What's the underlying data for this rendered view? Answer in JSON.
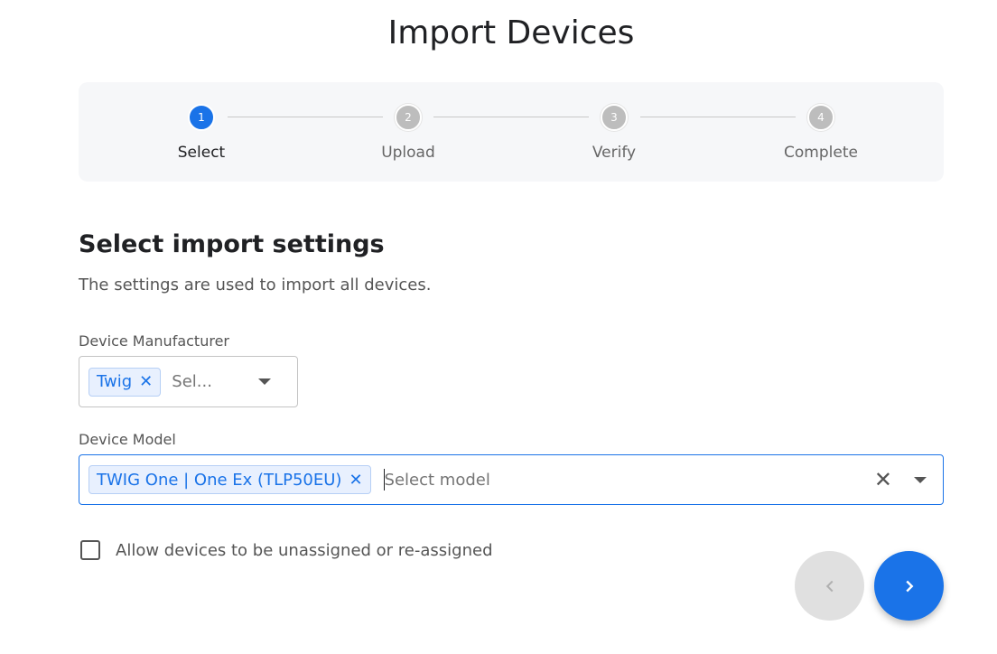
{
  "page": {
    "title": "Import Devices"
  },
  "stepper": {
    "steps": [
      {
        "number": "1",
        "label": "Select",
        "state": "active"
      },
      {
        "number": "2",
        "label": "Upload",
        "state": "inactive"
      },
      {
        "number": "3",
        "label": "Verify",
        "state": "inactive"
      },
      {
        "number": "4",
        "label": "Complete",
        "state": "inactive"
      }
    ]
  },
  "section": {
    "title": "Select import settings",
    "subtitle": "The settings are used to import all devices."
  },
  "manufacturer": {
    "label": "Device Manufacturer",
    "chip": "Twig",
    "placeholder": "Sel..."
  },
  "model": {
    "label": "Device Model",
    "chip": "TWIG One | One Ex (TLP50EU)",
    "placeholder": "Select model"
  },
  "options": {
    "allow_unassign_label": "Allow devices to be unassigned or re-assigned",
    "allow_unassign_checked": false
  },
  "icons": {
    "chip_remove": "close-icon",
    "clear": "close-icon",
    "dropdown": "caret-down-icon",
    "prev": "chevron-left-icon",
    "next": "chevron-right-icon"
  },
  "colors": {
    "accent": "#1a73e8",
    "chip_bg": "#e8f0fe",
    "inactive_step": "#bdbdbd",
    "disabled_button": "#e0e0e0"
  }
}
